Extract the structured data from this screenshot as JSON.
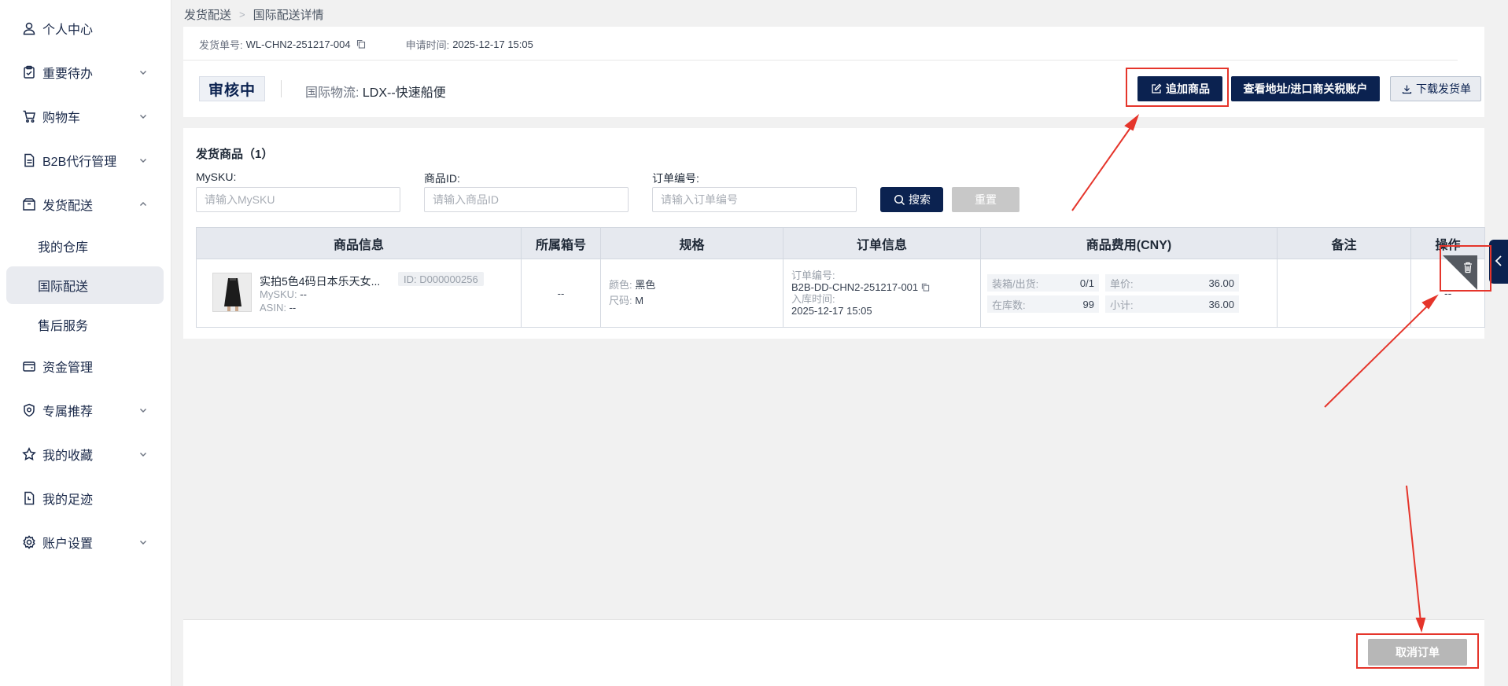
{
  "sidebar": {
    "items": [
      {
        "label": "个人中心",
        "icon": "user-icon"
      },
      {
        "label": "重要待办",
        "icon": "clipboard-check-icon"
      },
      {
        "label": "购物车",
        "icon": "cart-icon"
      },
      {
        "label": "B2B代行管理",
        "icon": "document-icon"
      },
      {
        "label": "发货配送",
        "icon": "box-icon"
      },
      {
        "label": "资金管理",
        "icon": "wallet-icon"
      },
      {
        "label": "专属推荐",
        "icon": "badge-icon"
      },
      {
        "label": "我的收藏",
        "icon": "star-icon"
      },
      {
        "label": "我的足迹",
        "icon": "history-icon"
      },
      {
        "label": "账户设置",
        "icon": "gear-icon"
      }
    ],
    "sub_items": [
      {
        "label": "我的仓库"
      },
      {
        "label": "国际配送"
      },
      {
        "label": "售后服务"
      }
    ]
  },
  "breadcrumb": {
    "parent": "发货配送",
    "current": "国际配送详情"
  },
  "header": {
    "ship_no_label": "发货单号:",
    "ship_no": "WL-CHN2-251217-004",
    "apply_time_label": "申请时间:",
    "apply_time": "2025-12-17 15:05",
    "status": "审核中",
    "logistics_label": "国际物流:",
    "logistics": "LDX--快速船便",
    "add_goods": "追加商品",
    "view_address": "查看地址/进口商关税账户",
    "download": "下载发货单"
  },
  "products": {
    "title": "发货商品（1）",
    "filters": {
      "mysku_label": "MySKU:",
      "mysku_placeholder": "请输入MySKU",
      "goods_id_label": "商品ID:",
      "goods_id_placeholder": "请输入商品ID",
      "order_no_label": "订单编号:",
      "order_no_placeholder": "请输入订单编号",
      "search": "搜索",
      "reset": "重置"
    },
    "columns": [
      "商品信息",
      "所属箱号",
      "规格",
      "订单信息",
      "商品费用(CNY)",
      "备注",
      "操作"
    ],
    "rows": [
      {
        "name": "实拍5色4码日本乐天女...",
        "id": "ID: D000000256",
        "mysku_label": "MySKU:",
        "mysku": "--",
        "asin_label": "ASIN:",
        "asin": "--",
        "box_no": "--",
        "color_label": "颜色:",
        "color": "黑色",
        "size_label": "尺码:",
        "size": "M",
        "order_no_label": "订单编号:",
        "order_no": "B2B-DD-CHN2-251217-001",
        "instock_label": "入库时间:",
        "instock_time": "2025-12-17 15:05",
        "pack_label": "装箱/出货:",
        "pack": "0/1",
        "stock_label": "在库数:",
        "stock": "99",
        "unit_label": "单价:",
        "unit_price": "36.00",
        "subtotal_label": "小计:",
        "subtotal": "36.00",
        "remark": "",
        "op": "--"
      }
    ]
  },
  "footer": {
    "cancel": "取消订单"
  },
  "colors": {
    "brand_navy": "#0b2250",
    "annotation_red": "#e5352b",
    "disabled_gray": "#b7b7b7"
  }
}
